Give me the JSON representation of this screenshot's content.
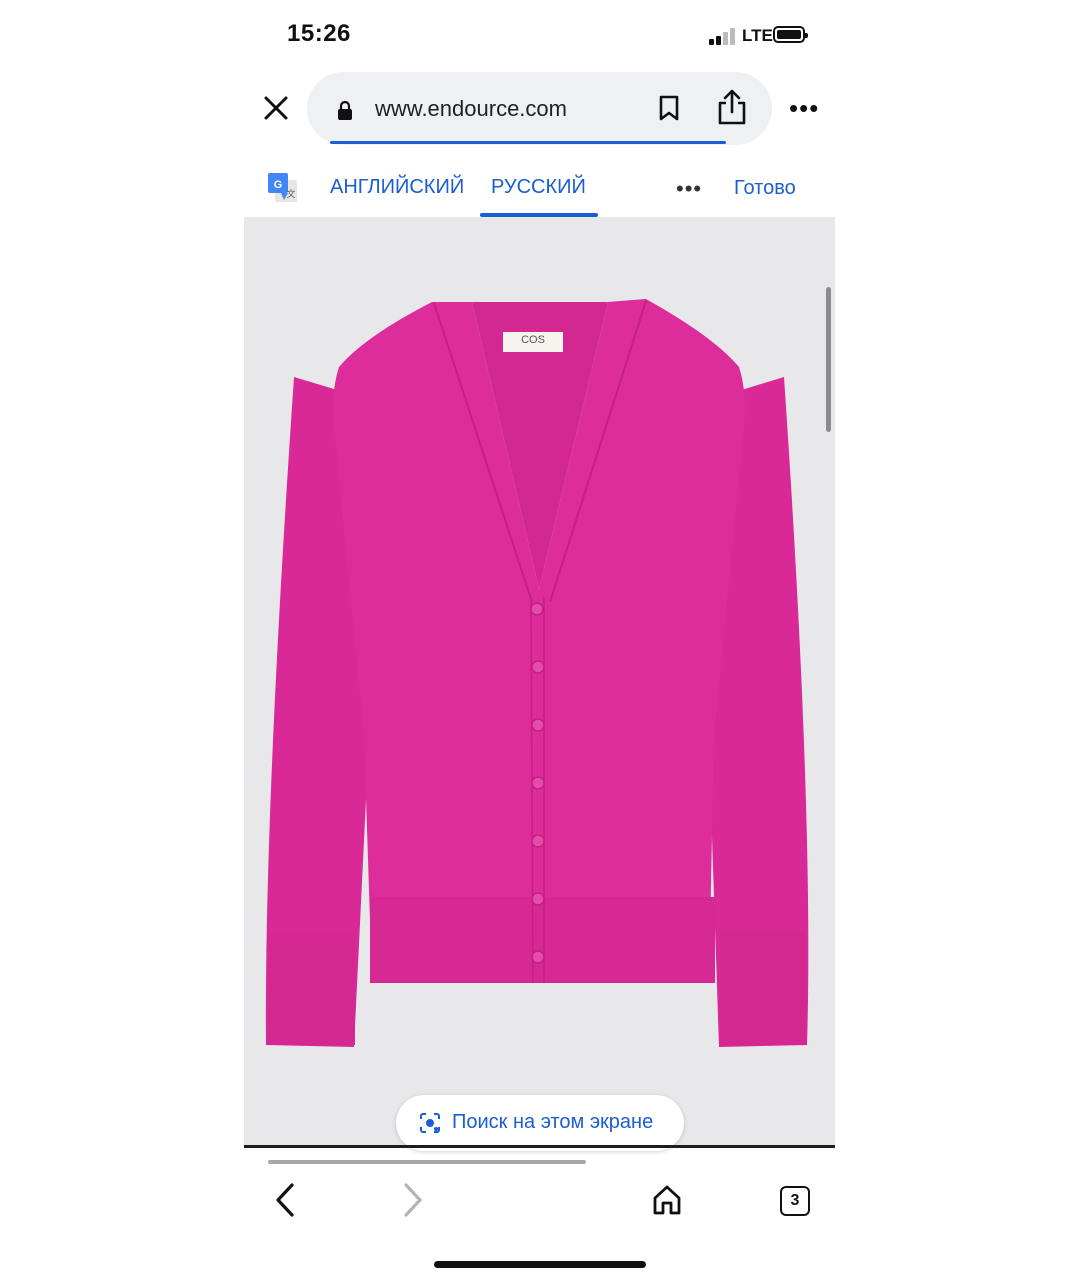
{
  "status_bar": {
    "time": "15:26",
    "network": "LTE",
    "signal_icon": "cellular-signal-icon",
    "battery_icon": "battery-icon"
  },
  "browser": {
    "url": "www.endource.com",
    "icons": {
      "close": "close-icon",
      "lock": "lock-icon",
      "bookmark": "bookmark-icon",
      "share": "share-icon",
      "more": "more-icon"
    },
    "more_label": "•••"
  },
  "translate_bar": {
    "icon": "google-translate-icon",
    "source_language": "АНГЛИЙСКИЙ",
    "target_language": "РУССКИЙ",
    "selected": "РУССКИЙ",
    "more_label": "•••",
    "done_label": "Готово"
  },
  "content": {
    "image_subject": "product-photo",
    "label_text": "COS",
    "colors": {
      "cardigan": "#dd2e9c",
      "background": "#e8e8ea"
    }
  },
  "search_screen": {
    "label": "Поиск на этом экране",
    "icon": "lens-icon"
  },
  "bottom_nav": {
    "tab_count": "3",
    "icons": {
      "back": "back-arrow-icon",
      "forward": "forward-arrow-icon",
      "home": "home-icon",
      "tabs": "tabs-icon"
    }
  },
  "colors": {
    "accent": "#1a5fd2",
    "text": "#111111"
  }
}
